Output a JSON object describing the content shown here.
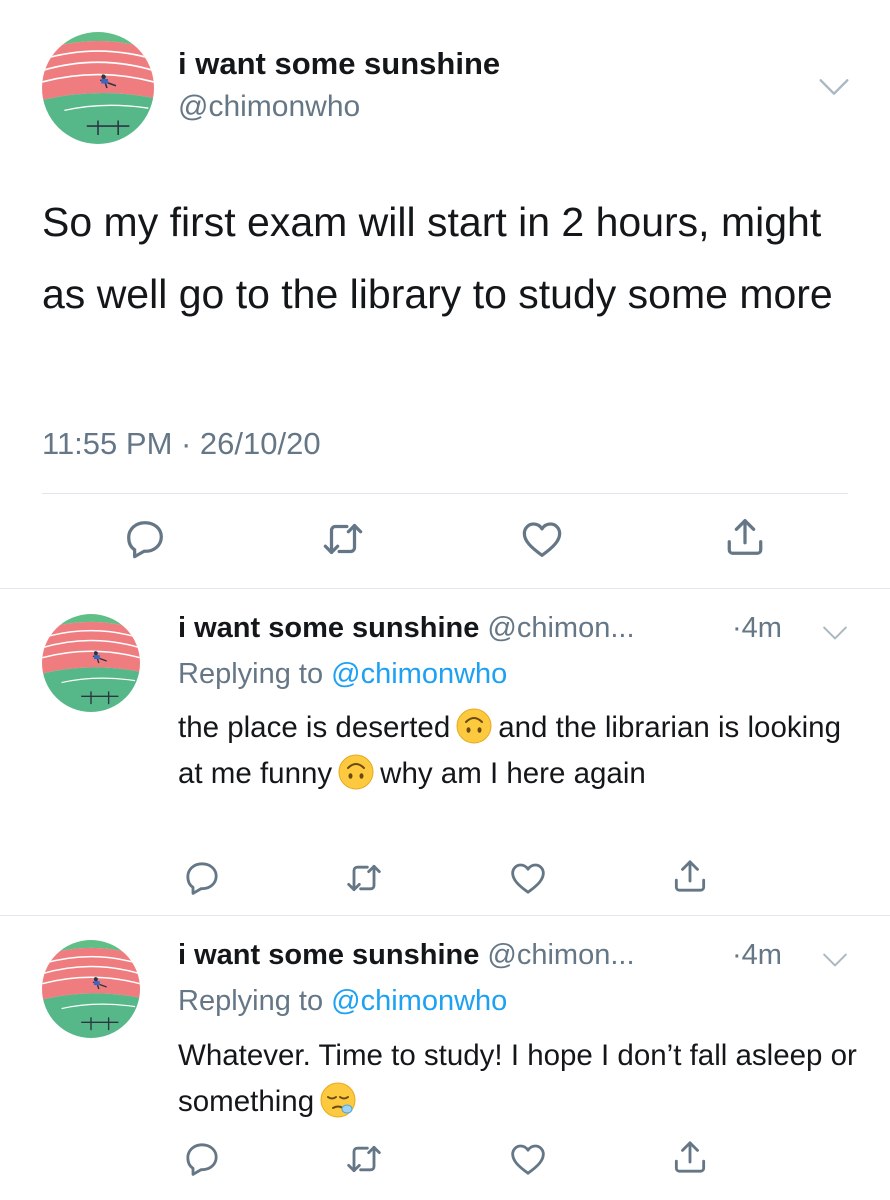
{
  "main_tweet": {
    "display_name": "i want some sunshine",
    "handle": "@chimonwho",
    "text": "So my first exam will start in 2 hours, might as well go to the library to study some more",
    "timestamp": "11:55 PM · 26/10/20"
  },
  "replies": [
    {
      "display_name": "i want some sunshine",
      "handle": "@chimon...",
      "time": "·4m",
      "replying_prefix": "Replying to ",
      "replying_to": "@chimonwho",
      "text_parts": [
        "the place is deserted",
        "and the librarian is looking at me funny",
        "why am I here again"
      ],
      "emojis": [
        "upside-down-face-emoji",
        "upside-down-face-emoji"
      ]
    },
    {
      "display_name": "i want some sunshine",
      "handle": "@chimon...",
      "time": "·4m",
      "replying_prefix": "Replying to ",
      "replying_to": "@chimonwho",
      "text_parts": [
        "Whatever. Time to study! I hope I don’t fall asleep or something"
      ],
      "emojis": [
        "sleepy-face-emoji"
      ]
    }
  ],
  "icons": [
    "chevron-down-icon",
    "reply-icon",
    "retweet-icon",
    "like-icon",
    "share-icon"
  ],
  "colors": {
    "text": "#14171a",
    "secondary": "#657786",
    "link": "#1da1f2",
    "divider": "#e1e8ed",
    "icon": "#657786"
  }
}
